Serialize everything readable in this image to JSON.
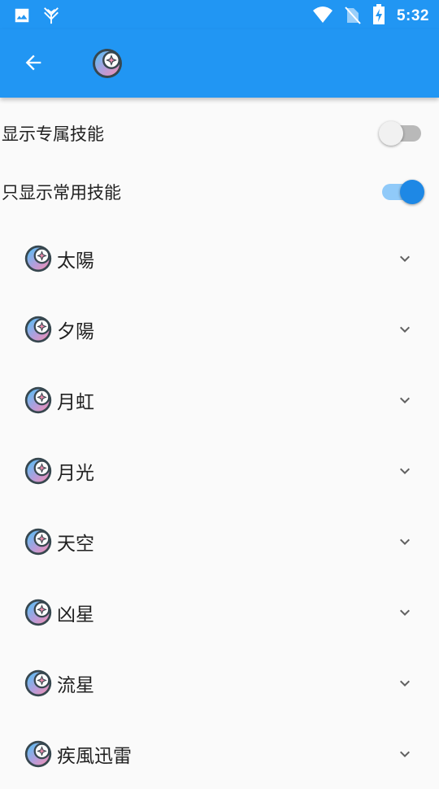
{
  "status_bar": {
    "time": "5:32",
    "left_icons": [
      "image-icon",
      "app-notification-icon"
    ],
    "right_icons": [
      "wifi-icon",
      "no-sim-icon",
      "battery-charging-icon"
    ]
  },
  "app_bar": {
    "back_icon": "arrow-back-icon",
    "logo_icon": "app-logo-icon"
  },
  "settings": {
    "show_exclusive_skills": {
      "label": "显示专属技能",
      "enabled": false
    },
    "show_common_only": {
      "label": "只显示常用技能",
      "enabled": true
    }
  },
  "skills": [
    {
      "label": "太陽"
    },
    {
      "label": "夕陽"
    },
    {
      "label": "月虹"
    },
    {
      "label": "月光"
    },
    {
      "label": "天空"
    },
    {
      "label": "凶星"
    },
    {
      "label": "流星"
    },
    {
      "label": "疾風迅雷"
    }
  ],
  "colors": {
    "primary": "#2196f3",
    "accent": "#1e88e5",
    "background": "#fafafa"
  }
}
